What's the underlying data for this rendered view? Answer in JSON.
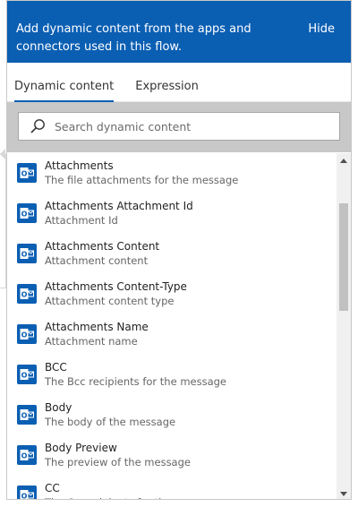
{
  "header": {
    "text": "Add dynamic content from the apps and connectors used in this flow.",
    "hide_label": "Hide"
  },
  "tabs": [
    {
      "label": "Dynamic content",
      "active": true
    },
    {
      "label": "Expression",
      "active": false
    }
  ],
  "search": {
    "placeholder": "Search dynamic content",
    "value": ""
  },
  "list_icon": "outlook-icon",
  "colors": {
    "accent": "#0b5fb3",
    "search_band": "#c8c8c8"
  },
  "items": [
    {
      "title": "Attachments",
      "description": "The file attachments for the message"
    },
    {
      "title": "Attachments Attachment Id",
      "description": "Attachment Id"
    },
    {
      "title": "Attachments Content",
      "description": "Attachment content"
    },
    {
      "title": "Attachments Content-Type",
      "description": "Attachment content type"
    },
    {
      "title": "Attachments Name",
      "description": "Attachment name"
    },
    {
      "title": "BCC",
      "description": "The Bcc recipients for the message"
    },
    {
      "title": "Body",
      "description": "The body of the message"
    },
    {
      "title": "Body Preview",
      "description": "The preview of the message"
    },
    {
      "title": "CC",
      "description": "The Cc recipients for the message"
    }
  ]
}
